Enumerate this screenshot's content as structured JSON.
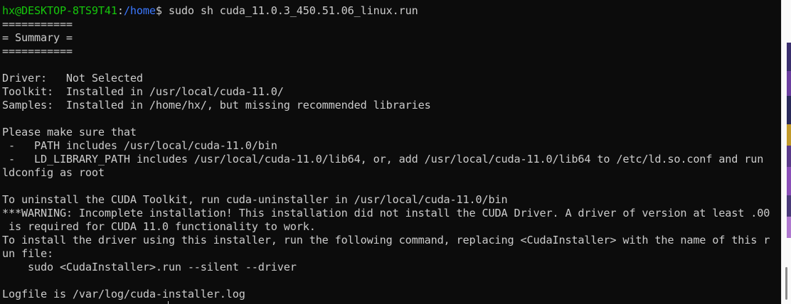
{
  "prompt": {
    "user_host": "hx@DESKTOP-8TS9T41",
    "separator": ":",
    "path": "/home",
    "symbol": "$",
    "command": " sudo sh cuda_11.0.3_450.51.06_linux.run"
  },
  "output_lines": [
    "===========",
    "= Summary =",
    "===========",
    "",
    "Driver:   Not Selected",
    "Toolkit:  Installed in /usr/local/cuda-11.0/",
    "Samples:  Installed in /home/hx/, but missing recommended libraries",
    "",
    "Please make sure that",
    " -   PATH includes /usr/local/cuda-11.0/bin",
    " -   LD_LIBRARY_PATH includes /usr/local/cuda-11.0/lib64, or, add /usr/local/cuda-11.0/lib64 to /etc/ld.so.conf and run",
    "ldconfig as root",
    "",
    "To uninstall the CUDA Toolkit, run cuda-uninstaller in /usr/local/cuda-11.0/bin",
    "***WARNING: Incomplete installation! This installation did not install the CUDA Driver. A driver of version at least .00",
    " is required for CUDA 11.0 functionality to work.",
    "To install the driver using this installer, run the following command, replacing <CudaInstaller> with the name of this r",
    "un file:",
    "    sudo <CudaInstaller>.run --silent --driver",
    "",
    "Logfile is /var/log/cuda-installer.log"
  ],
  "colors": {
    "background": "#0c0c0c",
    "text": "#cccccc",
    "prompt_user": "#16c60c",
    "prompt_path": "#3b78ff"
  }
}
